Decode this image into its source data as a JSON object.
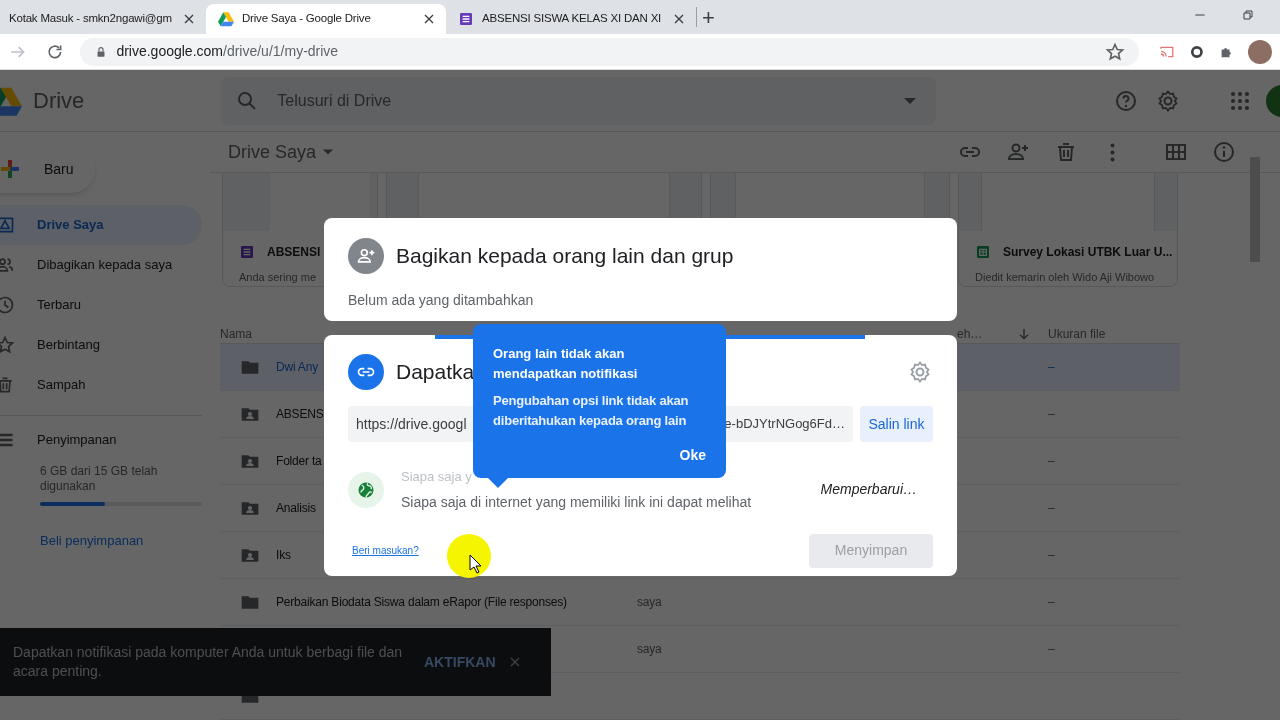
{
  "browser": {
    "tabs": [
      {
        "title": "Kotak Masuk - smkn2ngawi@gm",
        "kind": "mail",
        "selected": false
      },
      {
        "title": "Drive Saya - Google Drive",
        "kind": "drive",
        "selected": true
      },
      {
        "title": "ABSENSI SISWA KELAS XI DAN XI",
        "kind": "forms",
        "selected": false
      }
    ],
    "new_tab": "+",
    "url_host": "drive.google.com",
    "url_path": "/drive/u/1/my-drive"
  },
  "app": {
    "name": "Drive",
    "search_placeholder": "Telusuri di Drive",
    "new_button": "Baru",
    "breadcrumb": "Drive Saya",
    "nav": [
      {
        "label": "Drive Saya",
        "selected": true
      },
      {
        "label": "Dibagikan kepada saya",
        "selected": false
      },
      {
        "label": "Terbaru",
        "selected": false
      },
      {
        "label": "Berbintang",
        "selected": false
      },
      {
        "label": "Sampah",
        "selected": false
      }
    ],
    "storage": {
      "label": "Penyimpanan",
      "usage": "6 GB dari 15 GB telah digunakan",
      "level": 0.4,
      "buy": "Beli penyimpanan"
    },
    "suggested": [
      {
        "kind": "forms",
        "title": "ABSENSI",
        "subtitle": "Anda sering me"
      },
      {
        "kind": "thumbnail"
      },
      {
        "kind": "thumbnail"
      },
      {
        "kind": "sheets",
        "title": "Survey Lokasi UTBK Luar U...",
        "subtitle": "Diedit kemarin oleh Wido Aji Wibowo"
      }
    ],
    "table": {
      "columns": [
        "Nama",
        "eh…",
        "Ukuran file"
      ],
      "rows": [
        {
          "kind": "folder",
          "name": "Dwi Any",
          "size": "–",
          "selected": true
        },
        {
          "kind": "shared",
          "name": "ABSENS",
          "size": "–",
          "selected": false
        },
        {
          "kind": "shared",
          "name": "Folder ta",
          "size": "–",
          "selected": false
        },
        {
          "kind": "shared",
          "name": "Analisis",
          "size": "–",
          "selected": false
        },
        {
          "kind": "shared",
          "name": "Iks",
          "size": "–",
          "selected": false
        },
        {
          "kind": "folder",
          "name": "Perbaikan Biodata Siswa dalam eRapor (File responses)",
          "owner": "saya",
          "size": "–",
          "selected": false
        },
        {
          "kind": "hidden",
          "owner": "saya",
          "size": "–",
          "selected": false
        },
        {
          "kind": "folder"
        }
      ]
    },
    "snackbar": {
      "message": "Dapatkan notifikasi pada komputer Anda untuk berbagi file dan acara penting.",
      "action": "AKTIFKAN"
    }
  },
  "share_dialog": {
    "people": {
      "title": "Bagikan kepada orang lain dan grup",
      "status": "Belum ada yang ditambahkan"
    },
    "link": {
      "title": "Dapatka",
      "url_start": "https://drive.googl",
      "url_end": "e-bDJYtrNGog6Fd…",
      "copy": "Salin link",
      "access_title": "Siapa saja y",
      "access_desc": "Siapa saja di internet yang memiliki link ini dapat melihat",
      "role": "Memperbarui…",
      "feedback": "Beri masukan?",
      "save": "Menyimpan",
      "save_disabled": true
    },
    "tooltip": {
      "title": "Orang lain tidak akan mendapatkan notifikasi",
      "body": "Pengubahan opsi link tidak akan diberitahukan kepada orang lain",
      "action": "Oke"
    }
  }
}
